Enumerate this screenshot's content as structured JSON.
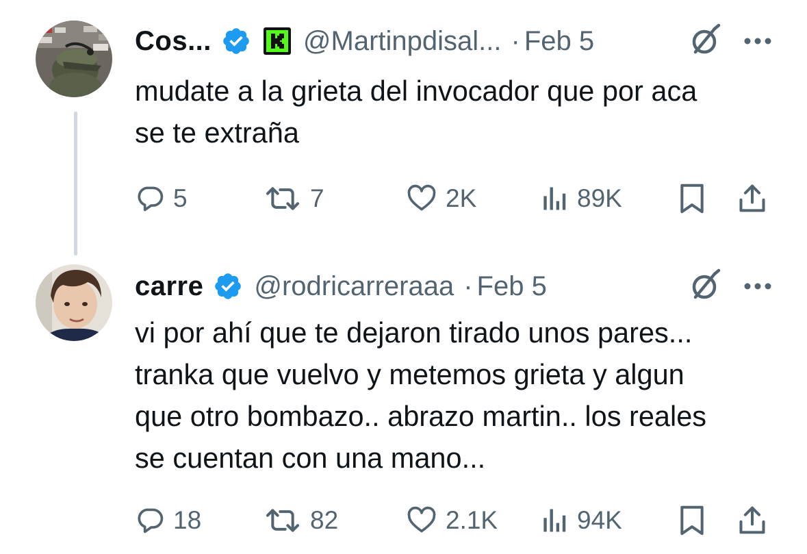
{
  "tweets": [
    {
      "display_name": "Cos...",
      "verified": true,
      "affiliate_badge": "kick-logo-icon",
      "handle": "@Martinpdisal...",
      "separator": "·",
      "date": "Feb 5",
      "text": "mudate a la grieta del invocador que por aca\nse te extraña",
      "stats": {
        "replies": "5",
        "reposts": "7",
        "likes": "2K",
        "views": "89K"
      }
    },
    {
      "display_name": "carre",
      "verified": true,
      "handle": "@rodricarreraaa",
      "separator": "·",
      "date": "Feb 5",
      "text": "vi por ahí que te dejaron tirado unos pares...\ntranka que vuelvo y metemos grieta y algun\nque otro bombazo.. abrazo martin.. los reales\nse cuentan con una mano...",
      "stats": {
        "replies": "18",
        "reposts": "82",
        "likes": "2.1K",
        "views": "94K"
      }
    }
  ],
  "colors": {
    "text": "#0f1419",
    "secondary": "#536471",
    "verified_blue": "#1d9bf0",
    "kick_green": "#53fc18",
    "thread_line": "#cfd9de"
  },
  "icons": {
    "reply": "reply-icon",
    "repost": "repost-icon",
    "like": "heart-icon",
    "views": "views-icon",
    "bookmark": "bookmark-icon",
    "share": "share-icon",
    "grok": "grok-icon",
    "more": "more-icon"
  }
}
